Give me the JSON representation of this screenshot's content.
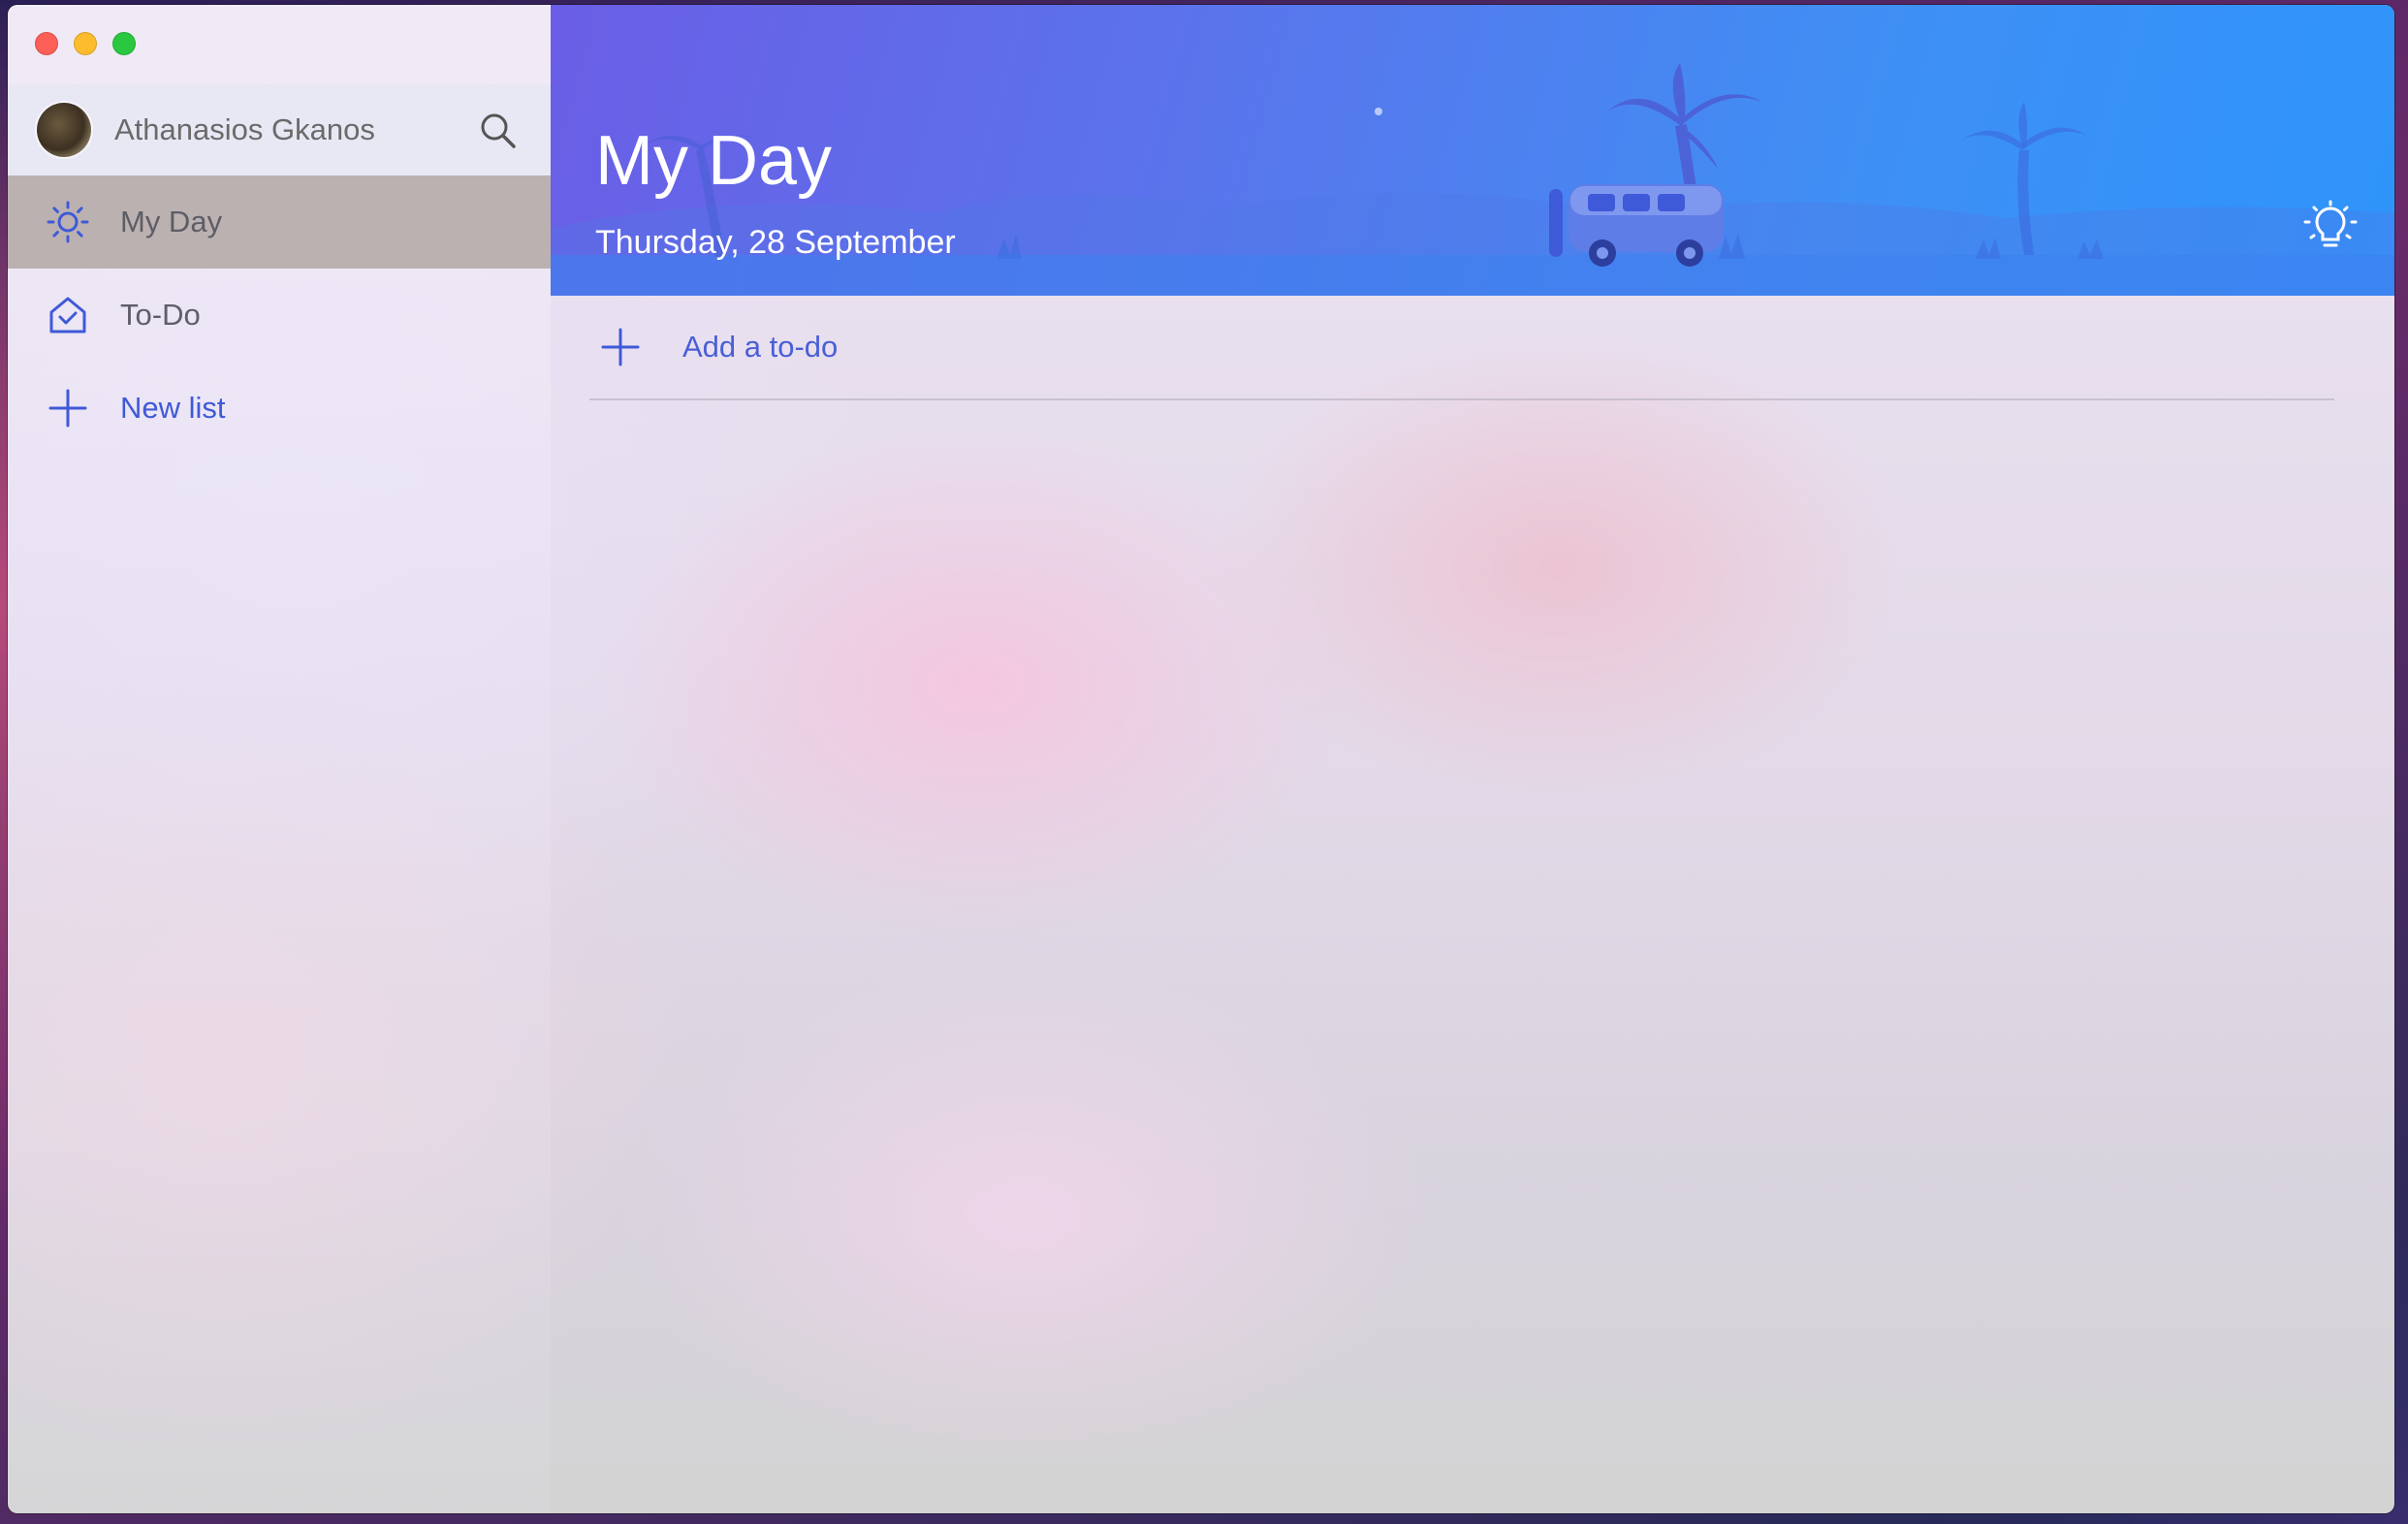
{
  "window": {
    "traffic_lights": [
      "close",
      "minimize",
      "zoom"
    ]
  },
  "user": {
    "name": "Athanasios Gkanos"
  },
  "sidebar": {
    "items": [
      {
        "label": "My Day",
        "icon": "sun-icon",
        "active": true
      },
      {
        "label": "To-Do",
        "icon": "house-check-icon",
        "active": false
      },
      {
        "label": "New list",
        "icon": "plus-icon",
        "active": false
      }
    ]
  },
  "main": {
    "title": "My Day",
    "date": "Thursday, 28 September",
    "add_todo_label": "Add a to-do"
  },
  "colors": {
    "accent": "#3f5ad8",
    "banner_start": "#6a5ee6",
    "banner_end": "#2e95fb",
    "active_item": "#bcb1b1"
  }
}
